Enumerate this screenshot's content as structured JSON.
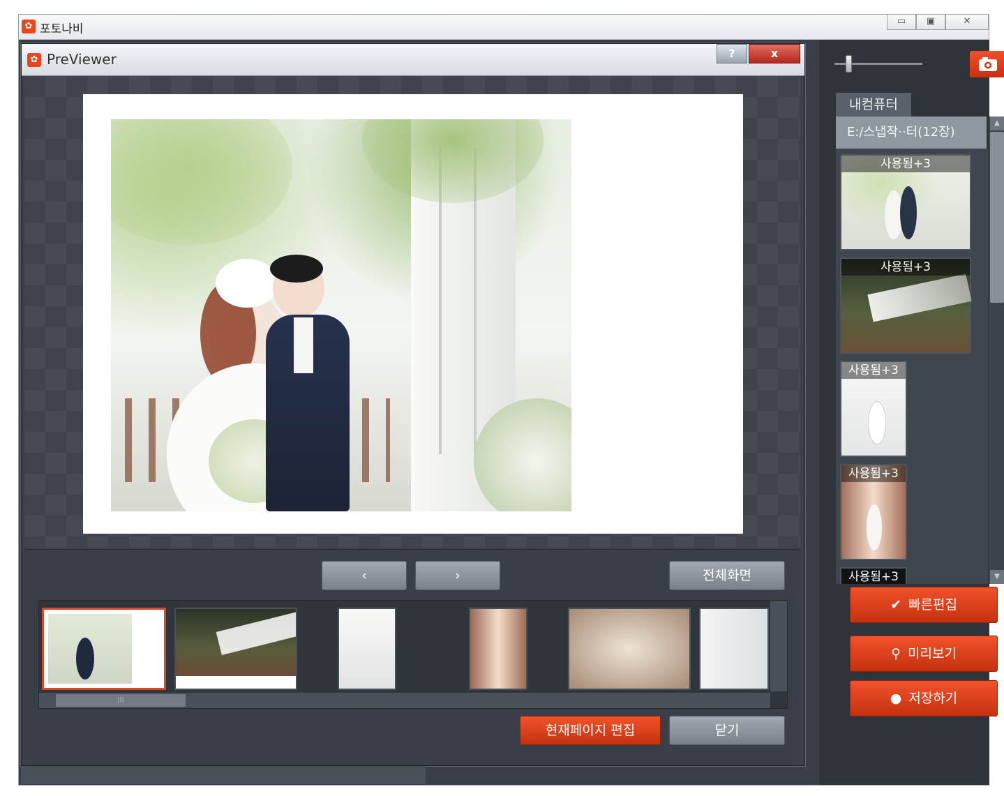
{
  "app": {
    "title": "포토나비",
    "logo_glyph": "✿",
    "window_controls": [
      "▭",
      "▣",
      "✕"
    ]
  },
  "dialog": {
    "title": "PreViewer",
    "help_label": "?",
    "close_label": "x",
    "prev_label": "‹",
    "next_label": "›",
    "fullscreen_label": "전체화면",
    "edit_current_label": "현재페이지 편집",
    "close_button_label": "닫기",
    "scroll_grip": "III"
  },
  "sidebar": {
    "tab_label": "내컴퓨터",
    "path": "E:/스냅작··터(12장)",
    "camera_icon": "camera-icon",
    "photos": [
      {
        "label": "사용됨+3"
      },
      {
        "label": "사용됨+3"
      },
      {
        "label": "사용됨+3"
      },
      {
        "label": "사용됨+3"
      },
      {
        "label": "사용됨+3"
      }
    ],
    "actions": [
      {
        "label": "빠른편집",
        "icon": "✔"
      },
      {
        "label": "미리보기",
        "icon": "⚲"
      },
      {
        "label": "저장하기",
        "icon": "●"
      }
    ]
  },
  "colors": {
    "accent": "#e0421c",
    "panel": "#3a3f47",
    "button_gray": "#8c929a"
  }
}
